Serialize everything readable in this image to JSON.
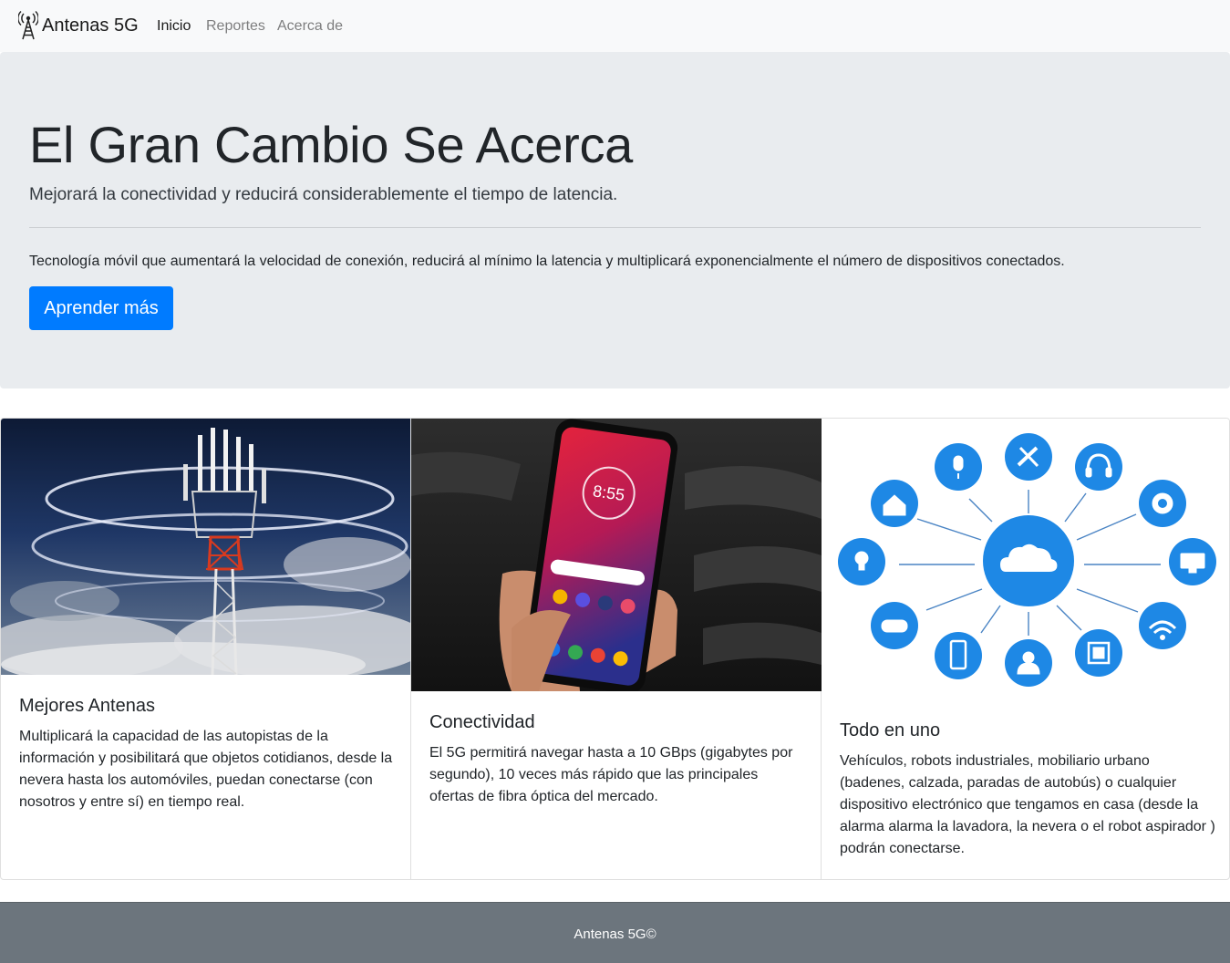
{
  "navbar": {
    "brand_icon": "antenna-tower-icon",
    "brand": "Antenas 5G",
    "links": [
      {
        "label": "Inicio",
        "active": true
      },
      {
        "label": "Reportes",
        "active": false
      },
      {
        "label": "Acerca de",
        "active": false
      }
    ]
  },
  "jumbotron": {
    "title": "El Gran Cambio Se Acerca",
    "lead": "Mejorará la conectividad y reducirá considerablemente el tiempo de latencia.",
    "text": "Tecnología móvil que aumentará la velocidad de conexión, reducirá al mínimo la latencia y multiplicará exponencialmente el número de dispositivos conectados.",
    "button": "Aprender más"
  },
  "cards": [
    {
      "image": "antenna-tower-photo",
      "title": "Mejores Antenas",
      "text": "Multiplicará la capacidad de las autopistas de la información y posibilitará que objetos cotidianos, desde la nevera hasta los automóviles, puedan conectarse (con nosotros y entre sí) en tiempo real."
    },
    {
      "image": "smartphone-photo",
      "title": "Conectividad",
      "text": "El 5G permitirá navegar hasta a 10 GBps (gigabytes por segundo), 10 veces más rápido que las principales ofertas de fibra óptica del mercado.",
      "phone_time": "8:55"
    },
    {
      "image": "cloud-devices-diagram",
      "title": "Todo en uno",
      "text": "Vehículos, robots industriales, mobiliario urbano (badenes, calzada, paradas de autobús) o cualquier dispositivo electrónico que tengamos en casa (desde la alarma alarma la lavadora, la nevera o el robot aspirador ) podrán conectarse.",
      "accent": "#1e88e5"
    }
  ],
  "footer": {
    "text": "Antenas 5G©"
  },
  "colors": {
    "primary": "#007bff",
    "navbar_bg": "#f8f9fa",
    "jumbotron_bg": "#e9ecef",
    "footer_bg": "#6c757d"
  }
}
